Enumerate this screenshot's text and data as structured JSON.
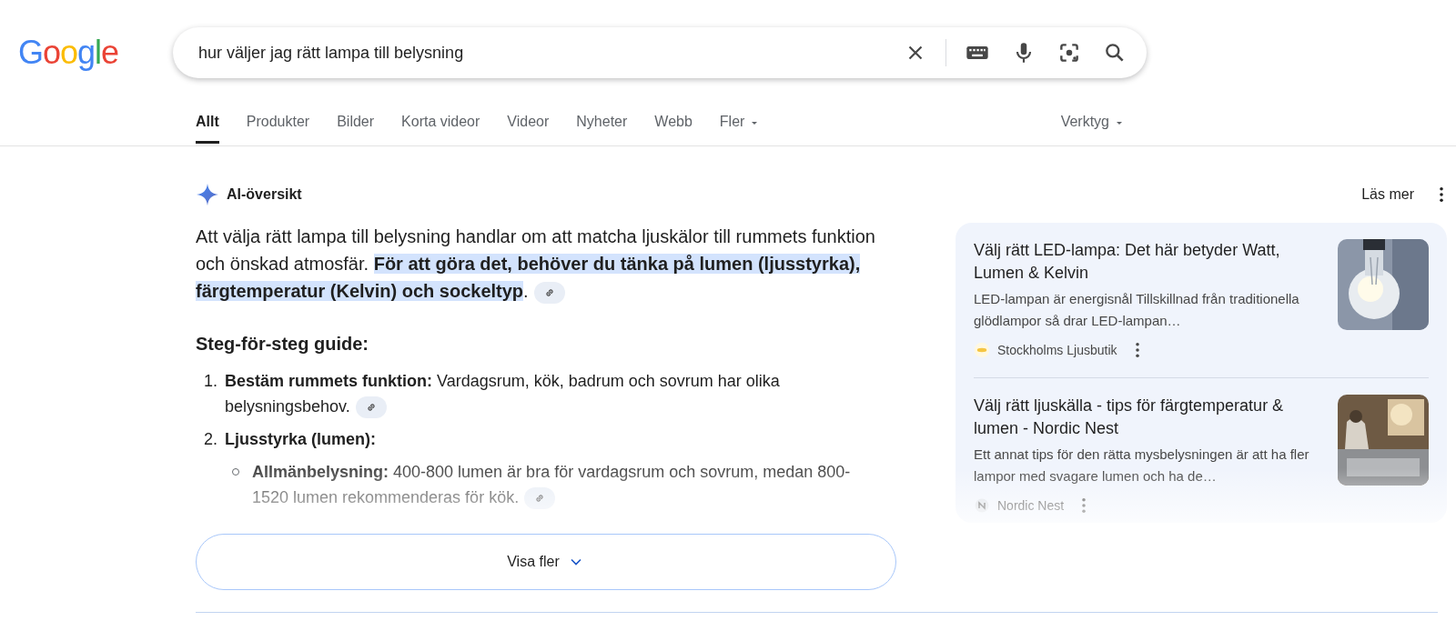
{
  "logo": "Google",
  "search": {
    "value": "hur väljer jag rätt lampa till belysning"
  },
  "tabs": [
    {
      "label": "Allt",
      "selected": true,
      "kind": "tab"
    },
    {
      "label": "Produkter",
      "selected": false,
      "kind": "tab"
    },
    {
      "label": "Bilder",
      "selected": false,
      "kind": "tab"
    },
    {
      "label": "Korta videor",
      "selected": false,
      "kind": "tab"
    },
    {
      "label": "Videor",
      "selected": false,
      "kind": "tab"
    },
    {
      "label": "Nyheter",
      "selected": false,
      "kind": "tab"
    },
    {
      "label": "Webb",
      "selected": false,
      "kind": "tab"
    },
    {
      "label": "Fler",
      "selected": false,
      "kind": "menu"
    }
  ],
  "tools": {
    "label": "Verktyg"
  },
  "ai_overview": {
    "title": "AI-översikt",
    "read_more": "Läs mer",
    "summary": {
      "text": "Att välja rätt lampa till belysning handlar om att matcha ljuskälor till rummets funktion och önskad atmosfär. ",
      "highlight": "För att göra det, behöver du tänka på lumen (ljusstyrka), färgtemperatur (Kelvin) och sockeltyp",
      "end": "."
    },
    "heading": "Steg-för-steg guide:",
    "steps": [
      {
        "number": "1.",
        "text": "**Bestäm rummets funktion:** Vardagsrum, kök, badrum och sovrum har olika belysningsbehov."
      },
      {
        "number": "2.",
        "text": "Ljusstyrka (lumen):",
        "children": [
          {
            "text": "**Allmänbelysning:** 400-800 lumen är bra för vardagsrum och sovrum, medan 800-1520 lumen rekommenderas för kök."
          }
        ]
      }
    ],
    "sources": [
      {
        "title": "Välj rätt LED-lampa: Det här betyder Watt, Lumen & Kelvin",
        "snippet": "LED-lampan är energisnål Tillskillnad från traditionella glödlampor så drar LED-lampan…",
        "site": "Stockholms Ljusbutik",
        "kind": "picture"
      },
      {
        "title": "Välj rätt ljuskälla - tips för färgtemperatur & lumen - Nordic Nest",
        "snippet": "Ett annat tips för den rätta mysbelysningen är att ha fler lampor med svagare lumen och ha de…",
        "site": "Nordic Nest",
        "kind": "picture"
      }
    ],
    "show_more": "Visa fler"
  }
}
